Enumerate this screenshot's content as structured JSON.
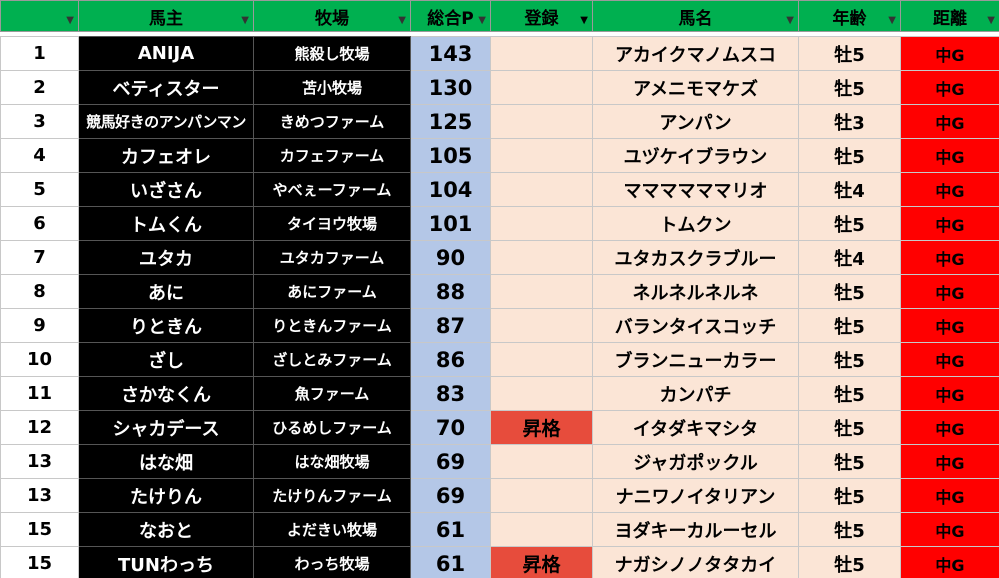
{
  "headers": {
    "rank": "",
    "owner": "馬主",
    "farm": "牧場",
    "points": "総合P",
    "registration": "登録",
    "horse": "馬名",
    "age": "年齢",
    "distance": "距離"
  },
  "filter_icon": "filter-dropdown-icon",
  "colors": {
    "header_bg": "#00b050",
    "owner_bg": "#000000",
    "points_bg": "#b4c7e7",
    "peach_bg": "#fbe5d6",
    "promo_bg": "#e74c3c",
    "distance_bg": "#ff0000"
  },
  "rows": [
    {
      "rank": "1",
      "owner": "ANIJA",
      "farm": "熊殺し牧場",
      "points": "143",
      "registration": "",
      "horse": "アカイクマノムスコ",
      "age": "牡5",
      "distance": "中G"
    },
    {
      "rank": "2",
      "owner": "ベティスター",
      "farm": "苫小牧場",
      "points": "130",
      "registration": "",
      "horse": "アメニモマケズ",
      "age": "牡5",
      "distance": "中G"
    },
    {
      "rank": "3",
      "owner": "競馬好きのアンパンマン",
      "farm": "きめつファーム",
      "points": "125",
      "registration": "",
      "horse": "アンパン",
      "age": "牡3",
      "distance": "中G"
    },
    {
      "rank": "4",
      "owner": "カフェオレ",
      "farm": "カフェファーム",
      "points": "105",
      "registration": "",
      "horse": "ユヅケイブラウン",
      "age": "牡5",
      "distance": "中G"
    },
    {
      "rank": "5",
      "owner": "いざさん",
      "farm": "やべぇーファーム",
      "points": "104",
      "registration": "",
      "horse": "ママママママリオ",
      "age": "牡4",
      "distance": "中G"
    },
    {
      "rank": "6",
      "owner": "トムくん",
      "farm": "タイヨウ牧場",
      "points": "101",
      "registration": "",
      "horse": "トムクン",
      "age": "牡5",
      "distance": "中G"
    },
    {
      "rank": "7",
      "owner": "ユタカ",
      "farm": "ユタカファーム",
      "points": "90",
      "registration": "",
      "horse": "ユタカスクラブルー",
      "age": "牡4",
      "distance": "中G"
    },
    {
      "rank": "8",
      "owner": "あに",
      "farm": "あにファーム",
      "points": "88",
      "registration": "",
      "horse": "ネルネルネルネ",
      "age": "牡5",
      "distance": "中G"
    },
    {
      "rank": "9",
      "owner": "りときん",
      "farm": "りときんファーム",
      "points": "87",
      "registration": "",
      "horse": "バランタイスコッチ",
      "age": "牡5",
      "distance": "中G"
    },
    {
      "rank": "10",
      "owner": "ざし",
      "farm": "ざしとみファーム",
      "points": "86",
      "registration": "",
      "horse": "ブランニューカラー",
      "age": "牡5",
      "distance": "中G"
    },
    {
      "rank": "11",
      "owner": "さかなくん",
      "farm": "魚ファーム",
      "points": "83",
      "registration": "",
      "horse": "カンパチ",
      "age": "牡5",
      "distance": "中G"
    },
    {
      "rank": "12",
      "owner": "シャカデース",
      "farm": "ひるめしファーム",
      "points": "70",
      "registration": "昇格",
      "horse": "イタダキマシタ",
      "age": "牡5",
      "distance": "中G"
    },
    {
      "rank": "13",
      "owner": "はな畑",
      "farm": "はな畑牧場",
      "points": "69",
      "registration": "",
      "horse": "ジャガポックル",
      "age": "牡5",
      "distance": "中G"
    },
    {
      "rank": "13",
      "owner": "たけりん",
      "farm": "たけりんファーム",
      "points": "69",
      "registration": "",
      "horse": "ナニワノイタリアン",
      "age": "牡5",
      "distance": "中G"
    },
    {
      "rank": "15",
      "owner": "なおと",
      "farm": "よだきい牧場",
      "points": "61",
      "registration": "",
      "horse": "ヨダキーカルーセル",
      "age": "牡5",
      "distance": "中G"
    },
    {
      "rank": "15",
      "owner": "TUNわっち",
      "farm": "わっち牧場",
      "points": "61",
      "registration": "昇格",
      "horse": "ナガシノノタタカイ",
      "age": "牡5",
      "distance": "中G"
    }
  ]
}
